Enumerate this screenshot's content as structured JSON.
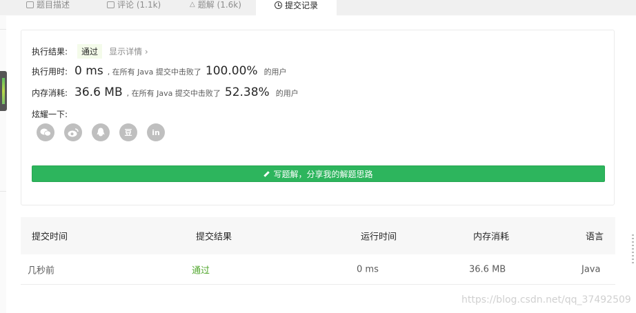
{
  "tabs": [
    {
      "label": "题目描述",
      "icon": "description-icon"
    },
    {
      "label": "评论 (1.1k)",
      "icon": "comment-icon"
    },
    {
      "label": "题解 (1.6k)",
      "icon": "solution-icon"
    },
    {
      "label": "提交记录",
      "icon": "clock-icon"
    }
  ],
  "result": {
    "label": "执行结果:",
    "status": "通过",
    "detail": "显示详情 ›"
  },
  "runtime": {
    "label": "执行用时:",
    "value": "0 ms",
    "mid": ", 在所有 Java 提交中击败了",
    "percent": "100.00%",
    "suffix": "的用户"
  },
  "memory": {
    "label": "内存消耗:",
    "value": "36.6 MB",
    "mid": ", 在所有 Java 提交中击败了",
    "percent": "52.38%",
    "suffix": "的用户"
  },
  "share": {
    "label": "炫耀一下:",
    "icons": [
      "wechat-icon",
      "weibo-icon",
      "qq-icon",
      "douban-icon",
      "linkedin-icon"
    ],
    "douban_glyph": "豆",
    "linkedin_glyph": "in"
  },
  "write_button": "写题解，分享我的解题思路",
  "table": {
    "headers": [
      "提交时间",
      "提交结果",
      "运行时间",
      "内存消耗",
      "语言"
    ],
    "rows": [
      [
        "几秒前",
        "通过",
        "0 ms",
        "36.6 MB",
        "Java"
      ]
    ]
  },
  "watermark": "https://blog.csdn.net/qq_37492509",
  "colors": {
    "accent_green": "#2db55d",
    "pass_green": "#52a72e"
  }
}
